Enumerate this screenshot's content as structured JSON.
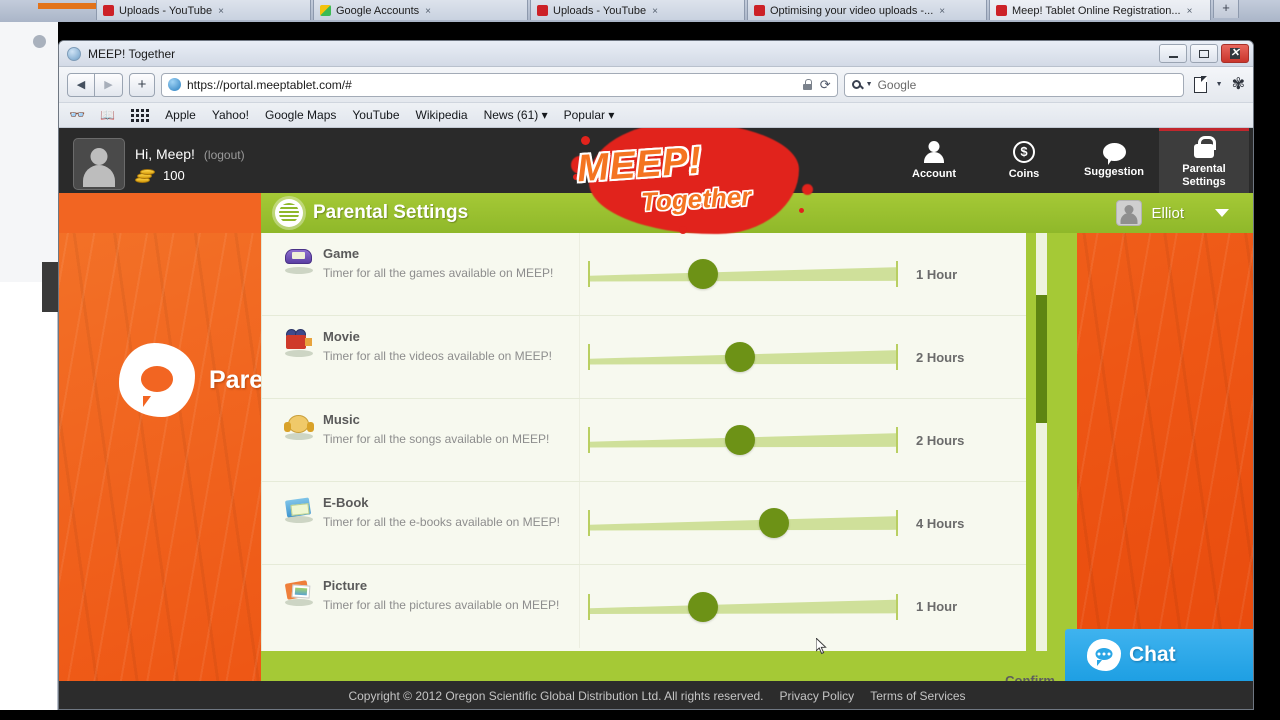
{
  "browser": {
    "window_title": "MEEP! Together",
    "url": "https://portal.meeptablet.com/#",
    "search_placeholder": "Google",
    "back_icon": "◀",
    "forward_icon": "▶",
    "new_tab_icon": "+",
    "reload_icon": "⟳",
    "tabs": [
      {
        "label": "Uploads - YouTube",
        "favicon": "youtube-icon",
        "active": false
      },
      {
        "label": "Google Accounts",
        "favicon": "google-icon",
        "active": false
      },
      {
        "label": "Uploads - YouTube",
        "favicon": "youtube-icon",
        "active": false
      },
      {
        "label": "Optimising your video uploads -...",
        "favicon": "youtube-icon",
        "active": false
      },
      {
        "label": "Meep! Tablet Online Registration...",
        "favicon": "youtube-icon",
        "active": true
      }
    ],
    "bookmarks": [
      "Apple",
      "Yahoo!",
      "Google Maps",
      "YouTube",
      "Wikipedia",
      "News (61)",
      "Popular"
    ],
    "window_buttons": {
      "minimize": "minimize",
      "maximize": "maximize",
      "close": "✕"
    }
  },
  "app": {
    "greeting": "Hi, Meep!",
    "logout_label": "(logout)",
    "coins": "100",
    "logo_primary": "MEEP!",
    "logo_secondary": "Together",
    "nav": [
      {
        "label": "Account",
        "icon": "person-icon",
        "active": false
      },
      {
        "label": "Coins",
        "icon": "dollar-coin-icon",
        "active": false
      },
      {
        "label": "Suggestion",
        "icon": "speech-bubble-icon",
        "active": false
      },
      {
        "label": "Parental\nSettings",
        "label_line1": "Parental",
        "label_line2": "Settings",
        "icon": "lock-icon",
        "active": true
      }
    ],
    "page_title": "Parental Settings",
    "sidebar_title": "Paren",
    "child_profile": "Elliot",
    "confirm_label": "Confirm",
    "chat_label": "Chat",
    "accent_green": "#a5c936",
    "accent_orange": "#f26522",
    "knob_green": "#6d9216"
  },
  "settings": {
    "rows": [
      {
        "title": "Game",
        "desc": "Timer for all the games available on MEEP!",
        "value": "1 Hour",
        "knob_pct": 37,
        "icon": "game-icon"
      },
      {
        "title": "Movie",
        "desc": "Timer for all the videos available on MEEP!",
        "value": "2 Hours",
        "knob_pct": 49,
        "icon": "movie-icon"
      },
      {
        "title": "Music",
        "desc": "Timer for all the songs available on MEEP!",
        "value": "2 Hours",
        "knob_pct": 49,
        "icon": "music-icon"
      },
      {
        "title": "E-Book",
        "desc": "Timer for all the e-books available on MEEP!",
        "value": "4 Hours",
        "knob_pct": 60,
        "icon": "ebook-icon"
      },
      {
        "title": "Picture",
        "desc": "Timer for all the pictures available on MEEP!",
        "value": "1 Hour",
        "knob_pct": 37,
        "icon": "picture-icon"
      }
    ]
  },
  "footer": {
    "copyright": "Copyright © 2012 Oregon Scientific Global Distribution Ltd. All rights reserved.",
    "privacy": "Privacy Policy",
    "terms": "Terms of Services"
  }
}
